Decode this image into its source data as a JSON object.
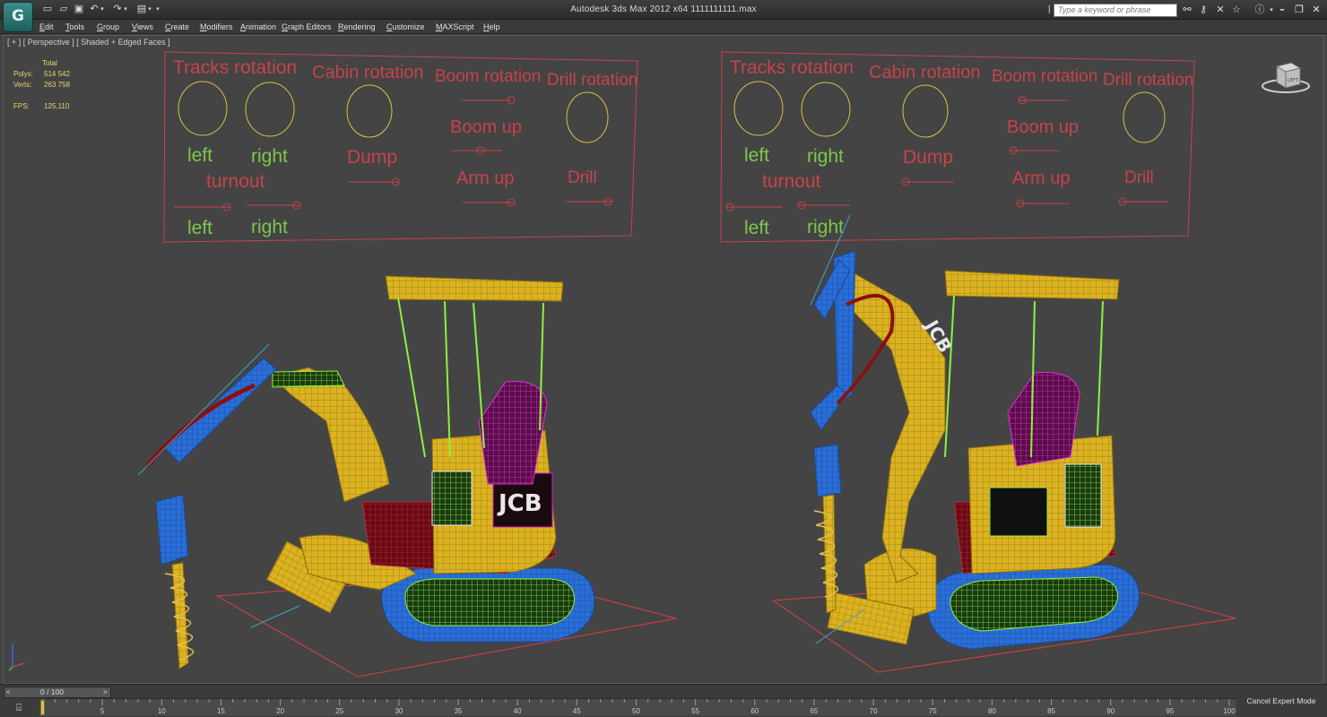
{
  "window": {
    "title": "Autodesk 3ds Max  2012 x64     1111111111.max",
    "app_logo": "3ds-max-logo",
    "search_placeholder": "Type a keyword or phrase",
    "icons": [
      "new-icon",
      "open-icon",
      "save-icon",
      "undo-icon",
      "redo-icon",
      "project-icon",
      "binoculars-icon",
      "subscription-icon",
      "communication-icon",
      "favorites-icon",
      "help-icon",
      "minimize-icon",
      "restore-icon",
      "close-icon"
    ],
    "accent_color": "#3a8f8a"
  },
  "menu": {
    "items": [
      "Edit",
      "Tools",
      "Group",
      "Views",
      "Create",
      "Modifiers",
      "Animation",
      "Graph Editors",
      "Rendering",
      "Customize",
      "MAXScript",
      "Help"
    ]
  },
  "viewport": {
    "label": "[ + ] [ Perspective ] [ Shaded + Edged Faces ]",
    "stats": {
      "header": "Total",
      "polys_label": "Polys:",
      "polys": "514 542",
      "verts_label": "Verts:",
      "verts": "263 758",
      "fps_label": "FPS:",
      "fps": "125,110"
    },
    "viewcube_label": "LEFT",
    "control_panels": [
      {
        "tracks_rotation": "Tracks rotation",
        "cabin_rotation": "Cabin rotation",
        "boom_rotation": "Boom rotation",
        "drill_rotation": "Drill rotation",
        "left": "left",
        "right": "right",
        "dump": "Dump",
        "turnout": "turnout",
        "boom_up": "Boom up",
        "arm_up": "Arm  up",
        "drill": "Drill",
        "left2": "left",
        "right2": "right"
      },
      {
        "tracks_rotation": "Tracks rotation",
        "cabin_rotation": "Cabin rotation",
        "boom_rotation": "Boom rotation",
        "drill_rotation": "Drill rotation",
        "left": "left",
        "right": "right",
        "dump": "Dump",
        "turnout": "turnout",
        "boom_up": "Boom up",
        "arm_up": "Arm  up",
        "drill": "Drill",
        "left2": "left",
        "right2": "right"
      }
    ],
    "model_badge": "JCB",
    "colors": {
      "panel_text": "#c8424a",
      "green_text": "#7dc84a",
      "circle": "#d8c04a",
      "body_yellow": "#e0b020",
      "tracks_blue": "#2a6ed8",
      "wire_green": "#8cf040",
      "accent_magenta": "#d020c0"
    }
  },
  "timeline": {
    "slider": "0 / 100",
    "prev": "<",
    "next": ">",
    "ticks": [
      "5",
      "10",
      "15",
      "20",
      "25",
      "30",
      "35",
      "40",
      "45",
      "50",
      "55",
      "60",
      "65",
      "70",
      "75",
      "80",
      "85",
      "90",
      "95",
      "100"
    ],
    "cancel_expert_mode": "Cancel Expert Mode"
  }
}
